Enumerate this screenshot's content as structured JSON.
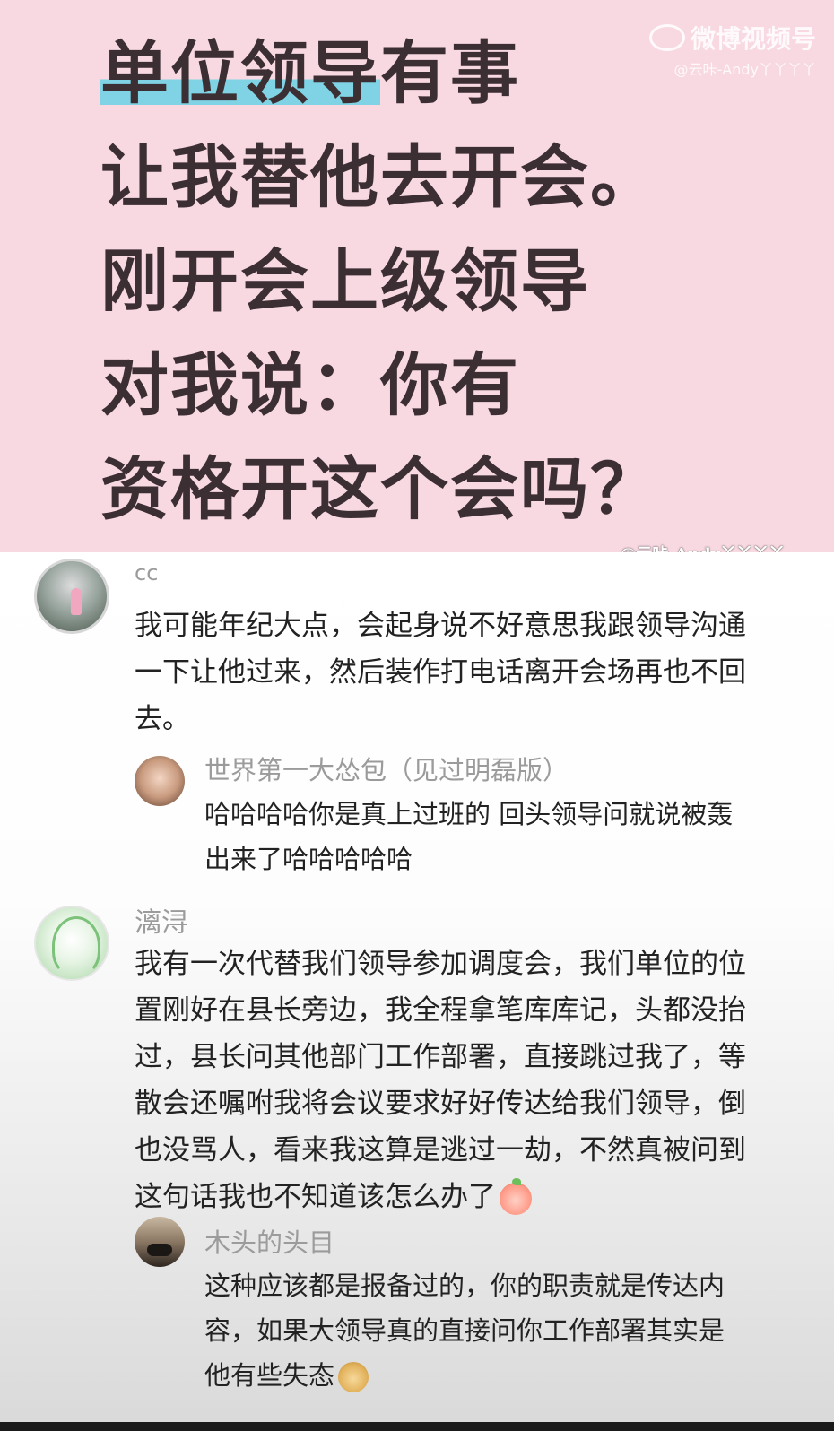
{
  "headline": {
    "highlight": "单位领导",
    "line1_rest": "有事",
    "line2": "让我替他去开会。",
    "line3": "刚开会上级领导",
    "line4": "对我说：你有",
    "line5": "资格开这个会吗？"
  },
  "watermark": {
    "brand": "微博视频号",
    "handle_top": "@云咔-Andy丫丫丫丫",
    "handle_mid": "@云咔-Andy丫丫丫丫"
  },
  "comments": [
    {
      "name": "cc",
      "text": "我可能年纪大点，会起身说不好意思我跟领导沟通\n一下让他过来，然后装作打电话离开会场再也不回\n去。"
    },
    {
      "name": "世界第一大怂包（见过明磊版）",
      "text": "哈哈哈哈你是真上过班的 回头领导问就说被轰\n出来了哈哈哈哈哈"
    },
    {
      "name": "漓浔",
      "text": "我有一次代替我们领导参加调度会，我们单位的位\n置刚好在县长旁边，我全程拿笔库库记，头都没抬\n过，县长问其他部门工作部署，直接跳过我了，等\n散会还嘱咐我将会议要求好好传达给我们领导，倒\n也没骂人，看来我这算是逃过一劫，不然真被问到\n这句话我也不知道该怎么办了"
    },
    {
      "name": "木头的头目",
      "text": "这种应该都是报备过的，你的职责就是传达内\n容，如果大领导真的直接问你工作部署其实是\n他有些失态"
    }
  ],
  "icons": {
    "emoji_1": "peach-emoji-icon",
    "emoji_2": "dog-emoji-icon"
  },
  "colors": {
    "banner_bg": "#f8d8e1",
    "highlight": "#7fd3e4",
    "headline_text": "#3b2f33",
    "name_text": "#9b9b9b"
  }
}
